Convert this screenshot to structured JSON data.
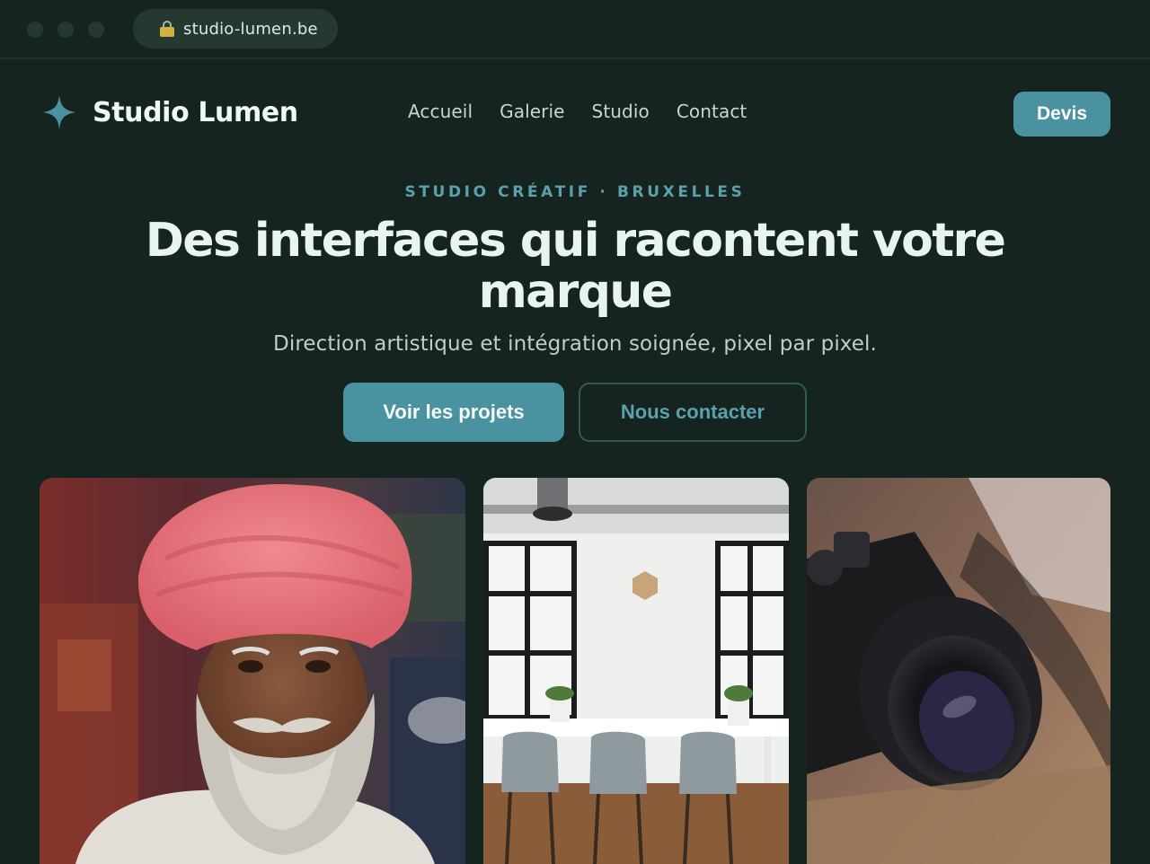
{
  "browser": {
    "url": "studio-lumen.be",
    "lock_icon": "lock-icon"
  },
  "header": {
    "brand": "Studio Lumen",
    "logo_icon": "sparkle-star-icon",
    "nav": [
      "Accueil",
      "Galerie",
      "Studio",
      "Contact"
    ],
    "cta_label": "Devis"
  },
  "hero": {
    "eyebrow": "STUDIO CRÉATIF · BRUXELLES",
    "headline": "Des interfaces qui racontent votre marque",
    "subline": "Direction artistique et intégration soignée, pixel par pixel.",
    "primary_button": "Voir les projets",
    "secondary_button": "Nous contacter"
  },
  "gallery": [
    {
      "subject": "portrait-man-pink-turban"
    },
    {
      "subject": "office-meeting-room"
    },
    {
      "subject": "vintage-camera-lens"
    }
  ],
  "colors": {
    "background": "#16241f",
    "accent": "#4b92a0",
    "accent_text": "#5aa1ad",
    "text": "#eaf4ef",
    "muted_text": "#bcd0c6"
  }
}
